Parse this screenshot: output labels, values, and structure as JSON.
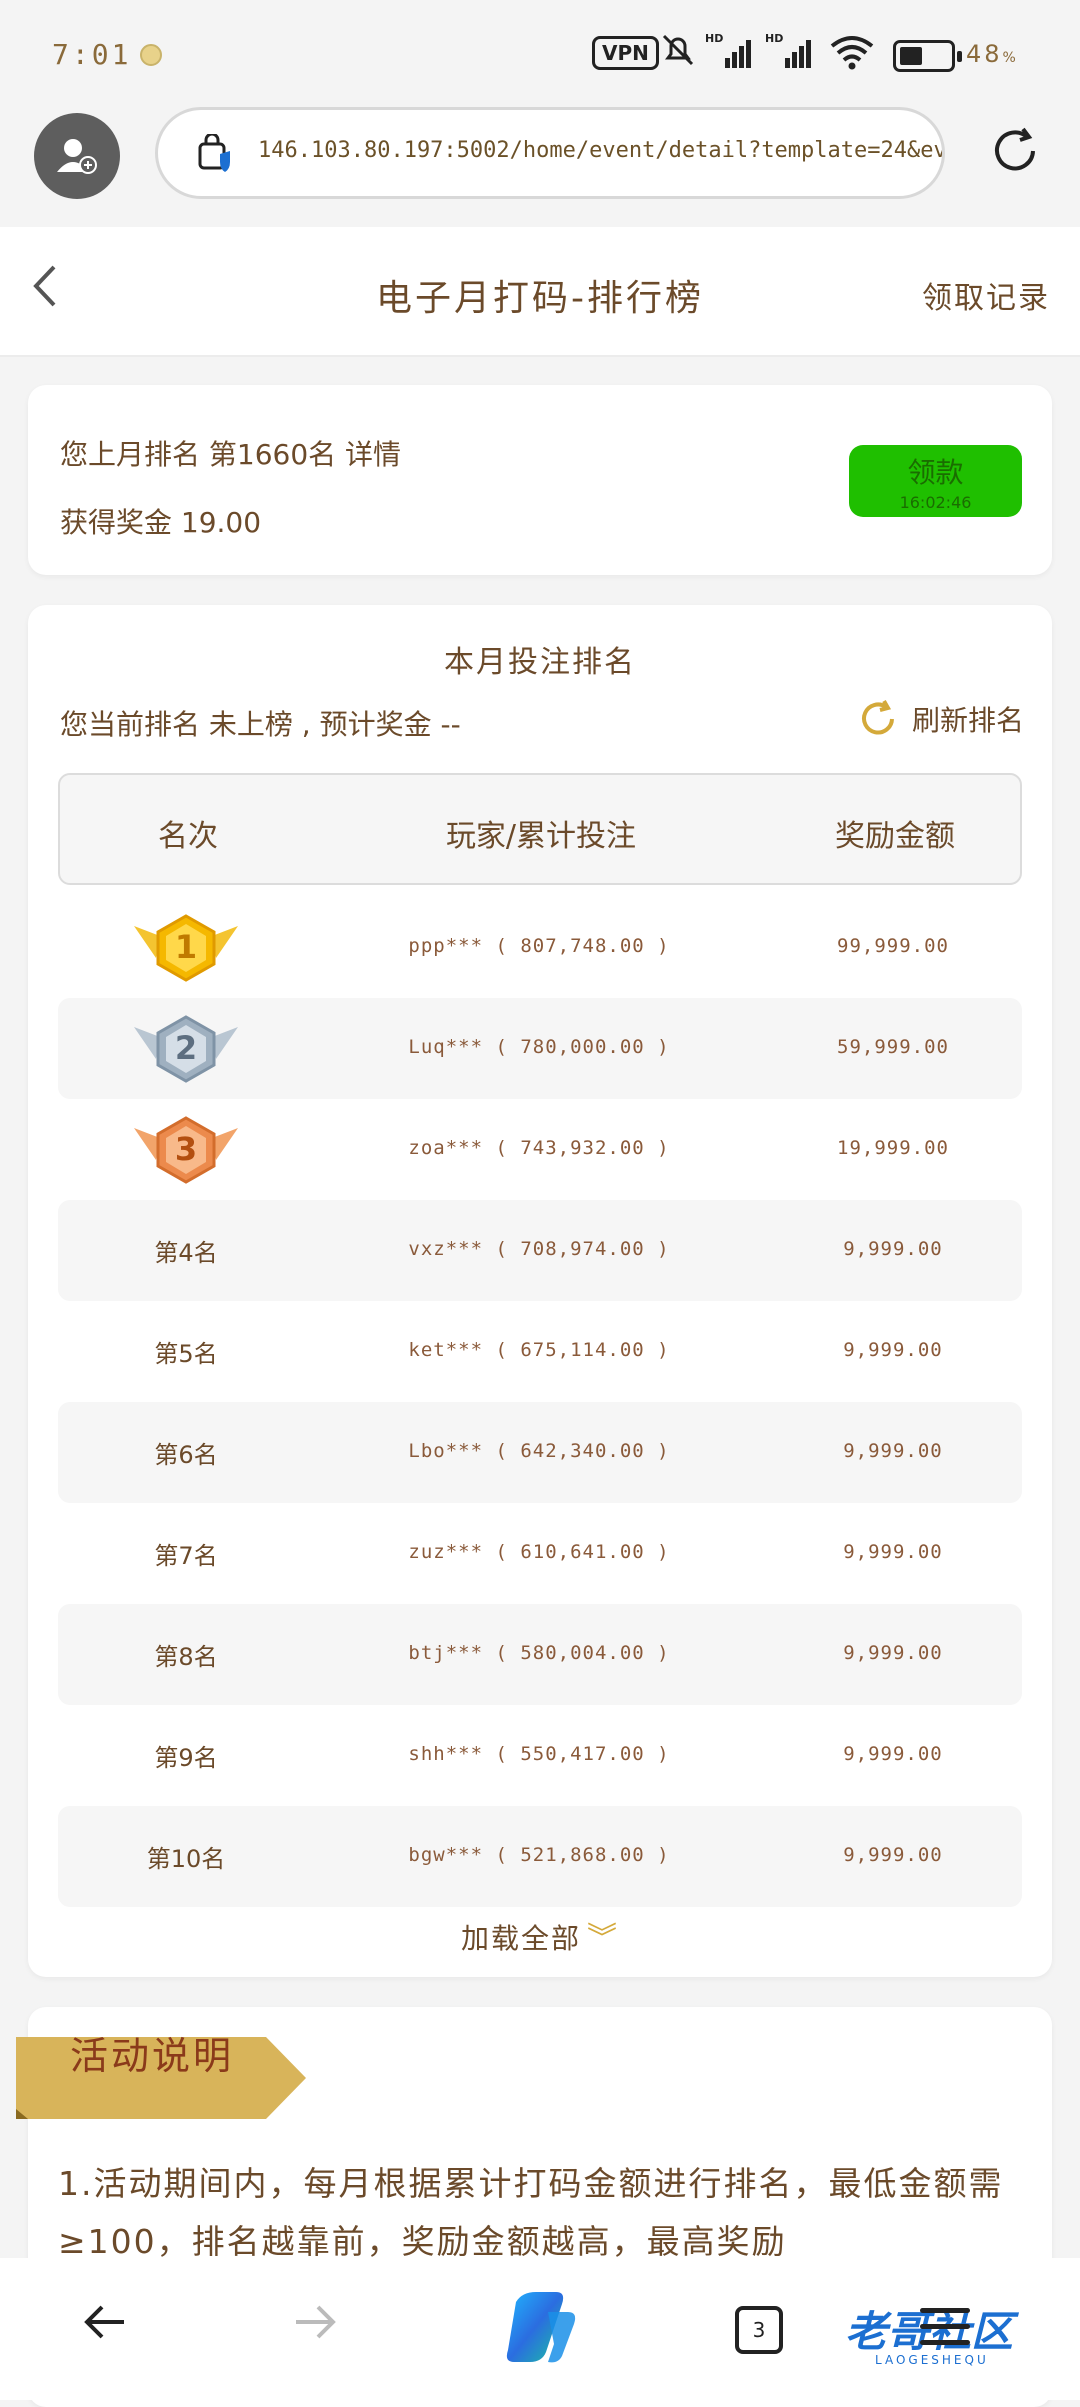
{
  "status_bar": {
    "time": "7:01",
    "vpn_label": "VPN",
    "battery_percent": "48",
    "battery_unit": "%"
  },
  "browser": {
    "url": "146.103.80.197:5002/home/event/detail?template=24&eve"
  },
  "header": {
    "back_icon": "back-arrow-icon",
    "title": "电子月打码-排行榜",
    "record_link": "领取记录"
  },
  "summary": {
    "last_month_text": "您上月排名 第1660名 详情",
    "bonus_text": "获得奖金 19.00",
    "claim_button": "领款",
    "claim_countdown": "16:02:46"
  },
  "ranking": {
    "title": "本月投注排名",
    "my_rank_text": "您当前排名 未上榜 , 预计奖金 --",
    "refresh_label": "刷新排名",
    "columns": [
      "名次",
      "玩家/累计投注",
      "奖励金额"
    ],
    "rows": [
      {
        "rank": "1",
        "player": "ppp*** ( 807,748.00 )",
        "prize": "99,999.00"
      },
      {
        "rank": "2",
        "player": "Luq*** ( 780,000.00 )",
        "prize": "59,999.00"
      },
      {
        "rank": "3",
        "player": "zoa*** ( 743,932.00 )",
        "prize": "19,999.00"
      },
      {
        "rank": "第4名",
        "player": "vxz*** ( 708,974.00 )",
        "prize": "9,999.00"
      },
      {
        "rank": "第5名",
        "player": "ket*** ( 675,114.00 )",
        "prize": "9,999.00"
      },
      {
        "rank": "第6名",
        "player": "Lbo*** ( 642,340.00 )",
        "prize": "9,999.00"
      },
      {
        "rank": "第7名",
        "player": "zuz*** ( 610,641.00 )",
        "prize": "9,999.00"
      },
      {
        "rank": "第8名",
        "player": "btj*** ( 580,004.00 )",
        "prize": "9,999.00"
      },
      {
        "rank": "第9名",
        "player": "shh*** ( 550,417.00 )",
        "prize": "9,999.00"
      },
      {
        "rank": "第10名",
        "player": "bgw*** ( 521,868.00 )",
        "prize": "9,999.00"
      }
    ],
    "load_all": "加载全部"
  },
  "activity": {
    "title": "活动说明",
    "description": "1.活动期间内，每月根据累计打码金额进行排名，最低金额需≥100，排名越靠前，奖励金额越高，最高奖励"
  },
  "bottom_nav": {
    "tab_count": "3",
    "watermark": "老哥社区",
    "watermark_sub": "LAOGESHEQU"
  },
  "colors": {
    "accent_gold": "#d4a93a",
    "claim_green": "#1fbf00",
    "text_brown": "#6b4a2a"
  }
}
